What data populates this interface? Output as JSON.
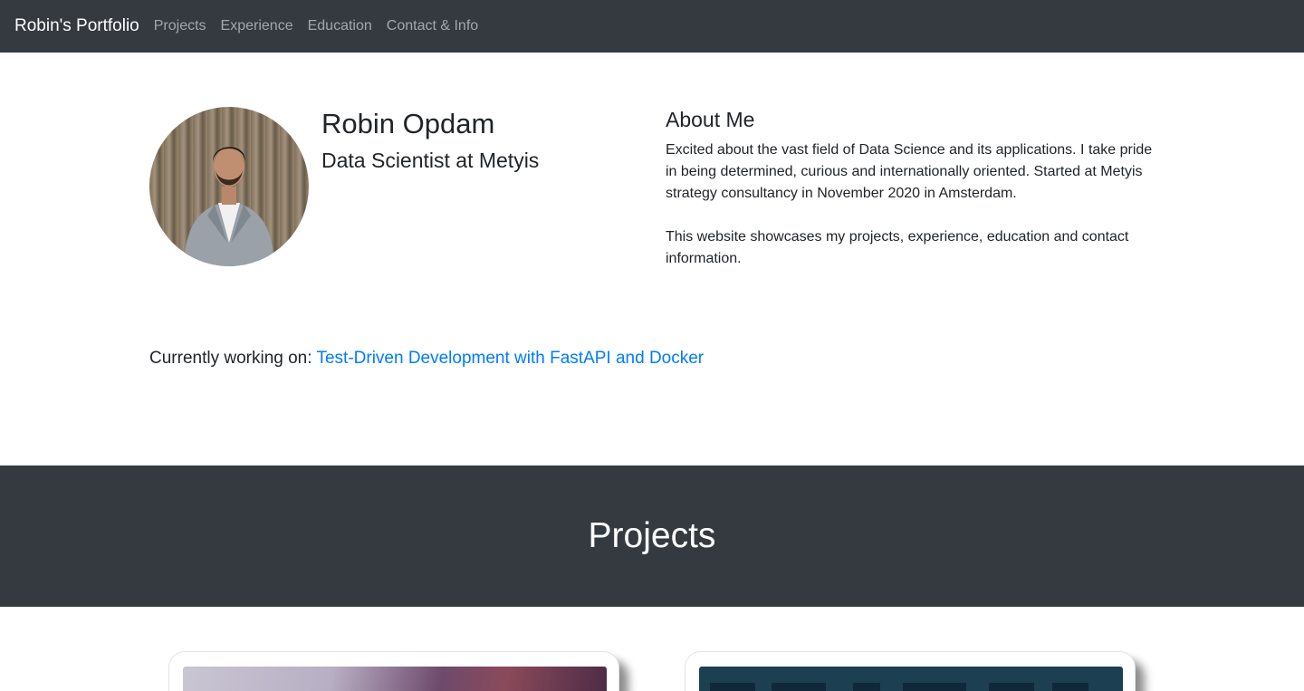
{
  "navbar": {
    "brand": "Robin's Portfolio",
    "links": [
      "Projects",
      "Experience",
      "Education",
      "Contact & Info"
    ]
  },
  "hero": {
    "name": "Robin Opdam",
    "role": "Data Scientist at Metyis",
    "avatar_icon": "profile-photo"
  },
  "about": {
    "title": "About Me",
    "paragraph1": "Excited about the vast field of Data Science and its applications. I take pride in being determined, curious and internationally oriented. Started at Metyis strategy consultancy in November 2020 in Amsterdam.",
    "paragraph2": "This website showcases my projects, experience, education and contact information."
  },
  "current": {
    "label": "Currently working on:",
    "link_text": "Test-Driven Development with FastAPI and Docker"
  },
  "projects": {
    "title": "Projects"
  },
  "colors": {
    "dark": "#343a40",
    "link": "#007bff",
    "text": "#212529"
  }
}
